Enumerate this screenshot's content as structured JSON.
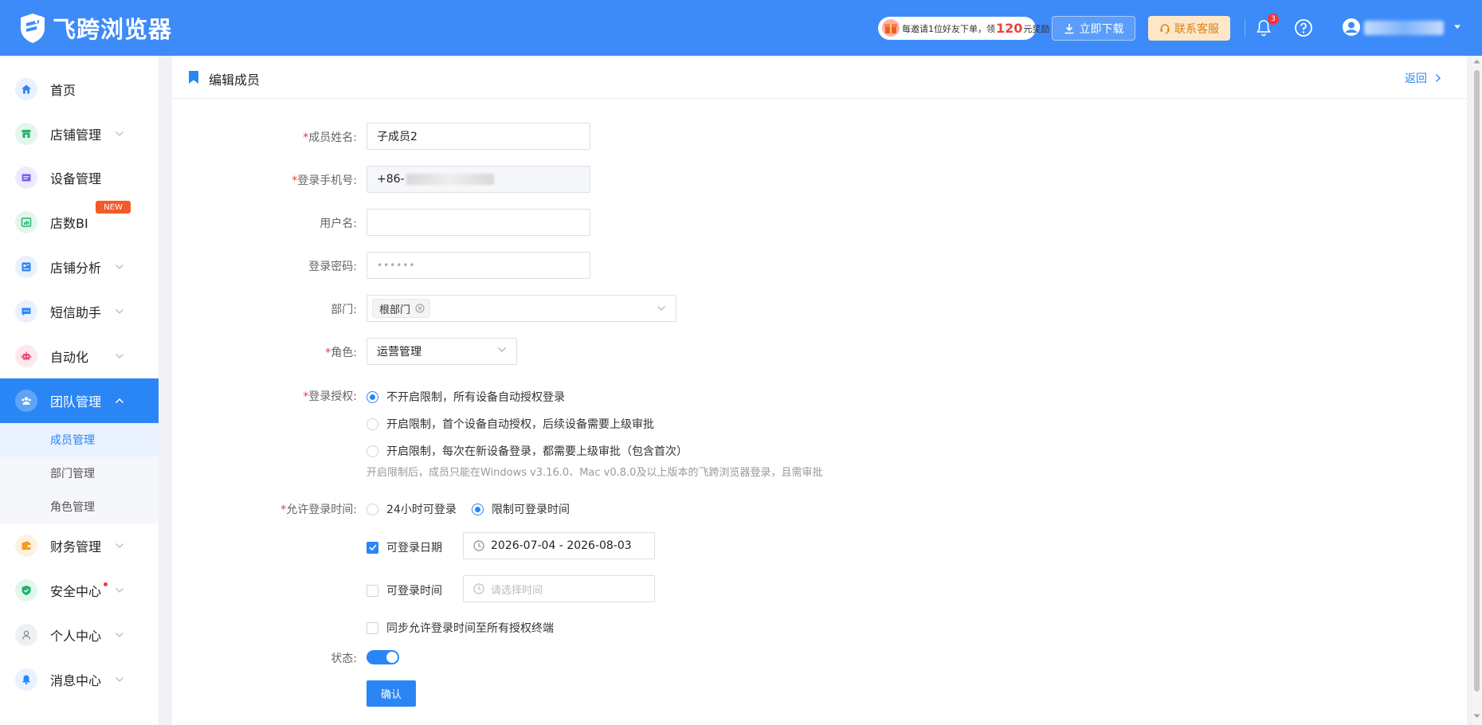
{
  "header": {
    "brand": "飞跨浏览器",
    "promo": {
      "prefix": "每邀请1位好友下单，领",
      "amount": "120",
      "suffix": "元奖励"
    },
    "download_label": "立即下载",
    "service_label": "联系客服",
    "notification_count": "3",
    "accent": "#3d8bf8"
  },
  "sidebar": {
    "items": [
      {
        "label": "首页",
        "icon": "home-icon",
        "color": "#2a86f5",
        "bg": "#e8f1fd"
      },
      {
        "label": "店铺管理",
        "icon": "store-icon",
        "color": "#1fb36b",
        "bg": "#e3f6ec"
      },
      {
        "label": "设备管理",
        "icon": "device-icon",
        "color": "#7b5cf0",
        "bg": "#eeeafd"
      },
      {
        "label": "店数BI",
        "icon": "bi-icon",
        "color": "#1fb36b",
        "bg": "#e3f6ec"
      },
      {
        "label": "店铺分析",
        "icon": "analysis-icon",
        "color": "#2a86f5",
        "bg": "#e8f1fd"
      },
      {
        "label": "短信助手",
        "icon": "sms-icon",
        "color": "#2a86f5",
        "bg": "#e8f1fd"
      },
      {
        "label": "自动化",
        "icon": "robot-icon",
        "color": "#ec4d78",
        "bg": "#fde8ee"
      },
      {
        "label": "团队管理",
        "icon": "team-icon",
        "color": "#ffffff",
        "bg": "#2a86f5"
      },
      {
        "label": "财务管理",
        "icon": "wallet-icon",
        "color": "#f59a23",
        "bg": "#fef1de"
      },
      {
        "label": "安全中心",
        "icon": "shield-icon",
        "color": "#1fb36b",
        "bg": "#e3f6ec"
      },
      {
        "label": "个人中心",
        "icon": "person-icon",
        "color": "#8a8f99",
        "bg": "#eef0f3"
      },
      {
        "label": "消息中心",
        "icon": "message-bell-icon",
        "color": "#2a86f5",
        "bg": "#e8f1fd"
      }
    ],
    "new_badge": "NEW",
    "team_sub": [
      "成员管理",
      "部门管理",
      "角色管理"
    ]
  },
  "page": {
    "title": "编辑成员",
    "back_label": "返回"
  },
  "form": {
    "name_label": "成员姓名:",
    "name_value": "子成员2",
    "phone_label": "登录手机号:",
    "phone_prefix": "+86-",
    "username_label": "用户名:",
    "username_value": "",
    "password_label": "登录密码:",
    "password_dots": "••••••",
    "dept_label": "部门:",
    "dept_tag": "根部门",
    "role_label": "角色:",
    "role_value": "运营管理",
    "auth_label": "登录授权:",
    "auth_options": [
      "不开启限制，所有设备自动授权登录",
      "开启限制，首个设备自动授权，后续设备需要上级审批",
      "开启限制，每次在新设备登录，都需要上级审批（包含首次）"
    ],
    "auth_hint": "开启限制后，成员只能在Windows v3.16.0、Mac v0.8.0及以上版本的飞跨浏览器登录，且需审批",
    "time_label": "允许登录时间:",
    "time_options": [
      "24小时可登录",
      "限制可登录时间"
    ],
    "date_check_label": "可登录日期",
    "date_range": "2026-07-04 - 2026-08-03",
    "time_check_label": "可登录时间",
    "time_placeholder": "请选择时间",
    "sync_label": "同步允许登录时间至所有授权终端",
    "status_label": "状态:",
    "confirm_label": "确认"
  }
}
